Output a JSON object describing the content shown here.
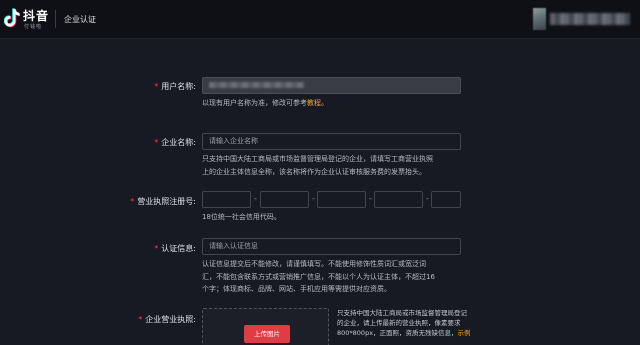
{
  "header": {
    "logo_title": "抖音",
    "logo_sub": "付钱啦",
    "page_title": "企业认证",
    "account_name": "[blurred]"
  },
  "form": {
    "username": {
      "label": "用户名称:",
      "value": "",
      "help_prefix": "以现有用户名称为准，修改可参考",
      "help_link": "教程",
      "help_suffix": "。"
    },
    "company_name": {
      "label": "企业名称:",
      "placeholder": "请输入企业名称",
      "help_line1": "只支持中国大陆工商局或市场监督管理局登记的企业，请填写工商营业执照",
      "help_line2": "上的企业主体信息全称，该名称将作为企业认证审核服务费的发票抬头。"
    },
    "license_number": {
      "label": "营业执照注册号:",
      "segments": [
        "",
        "",
        "",
        "",
        ""
      ],
      "separator": "-",
      "help": "18位统一社会信用代码。"
    },
    "certification_info": {
      "label": "认证信息:",
      "placeholder": "请输入认证信息",
      "help_line1": "认证信息提交后不能修改，请谨慎填写。不能使用修饰性质词汇或宽泛词",
      "help_line2": "汇，不能包含联系方式或营销推广信息，不能以个人为认证主体，不超过16",
      "help_line3": "个字；体现商标、品牌、网站、手机应用等需提供对应资质。"
    },
    "business_license": {
      "label": "企业营业执照:",
      "upload_button": "上传图片",
      "help_line1": "只支持中国大陆工商局或市场监督管理局登记",
      "help_line2": "的企业，请上传最新的营业执照，像素要求",
      "help_line3": "800*800px，正面照，资质无残缺信息，",
      "help_link": "示例"
    }
  },
  "colors": {
    "background": "#171923",
    "header_bg": "#0f1016",
    "required": "#f04142",
    "link": "#f4a726",
    "upload_button": "#e03c45"
  }
}
